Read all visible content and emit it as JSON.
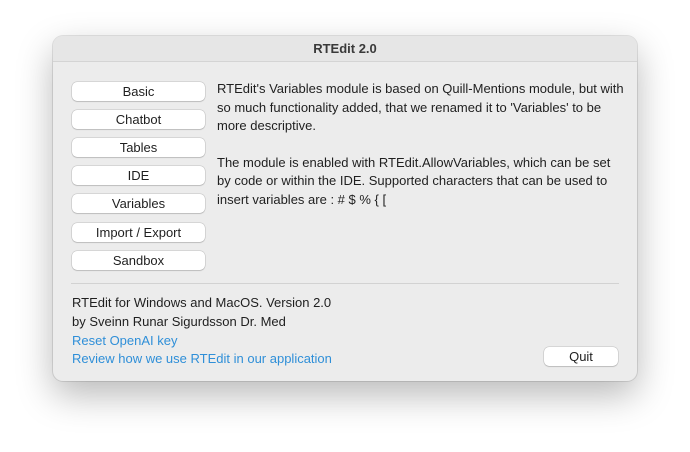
{
  "window": {
    "title": "RTEdit 2.0"
  },
  "nav": {
    "items": [
      {
        "label": "Basic"
      },
      {
        "label": "Chatbot"
      },
      {
        "label": "Tables"
      },
      {
        "label": "IDE"
      },
      {
        "label": "Variables"
      },
      {
        "label": "Import / Export"
      },
      {
        "label": "Sandbox"
      }
    ]
  },
  "content": {
    "paragraph1": "RTEdit's Variables module is based on Quill-Mentions module, but with so much functionality added, that we renamed it to 'Variables' to be more descriptive.",
    "paragraph2": "The module is enabled with RTEdit.AllowVariables, which can be set by code or within the IDE. Supported characters that can be used to insert variables are : # $ % { ["
  },
  "footer": {
    "version_text": "RTEdit for Windows and MacOS. Version 2.0",
    "author_text": "by Sveinn Runar Sigurdsson Dr. Med",
    "reset_link": "Reset OpenAI key",
    "review_link": "Review how we use RTEdit in our application",
    "quit_label": "Quit"
  },
  "colors": {
    "window_bg": "#ececec",
    "link": "#2f8fd8",
    "button_bg": "#ffffff"
  }
}
